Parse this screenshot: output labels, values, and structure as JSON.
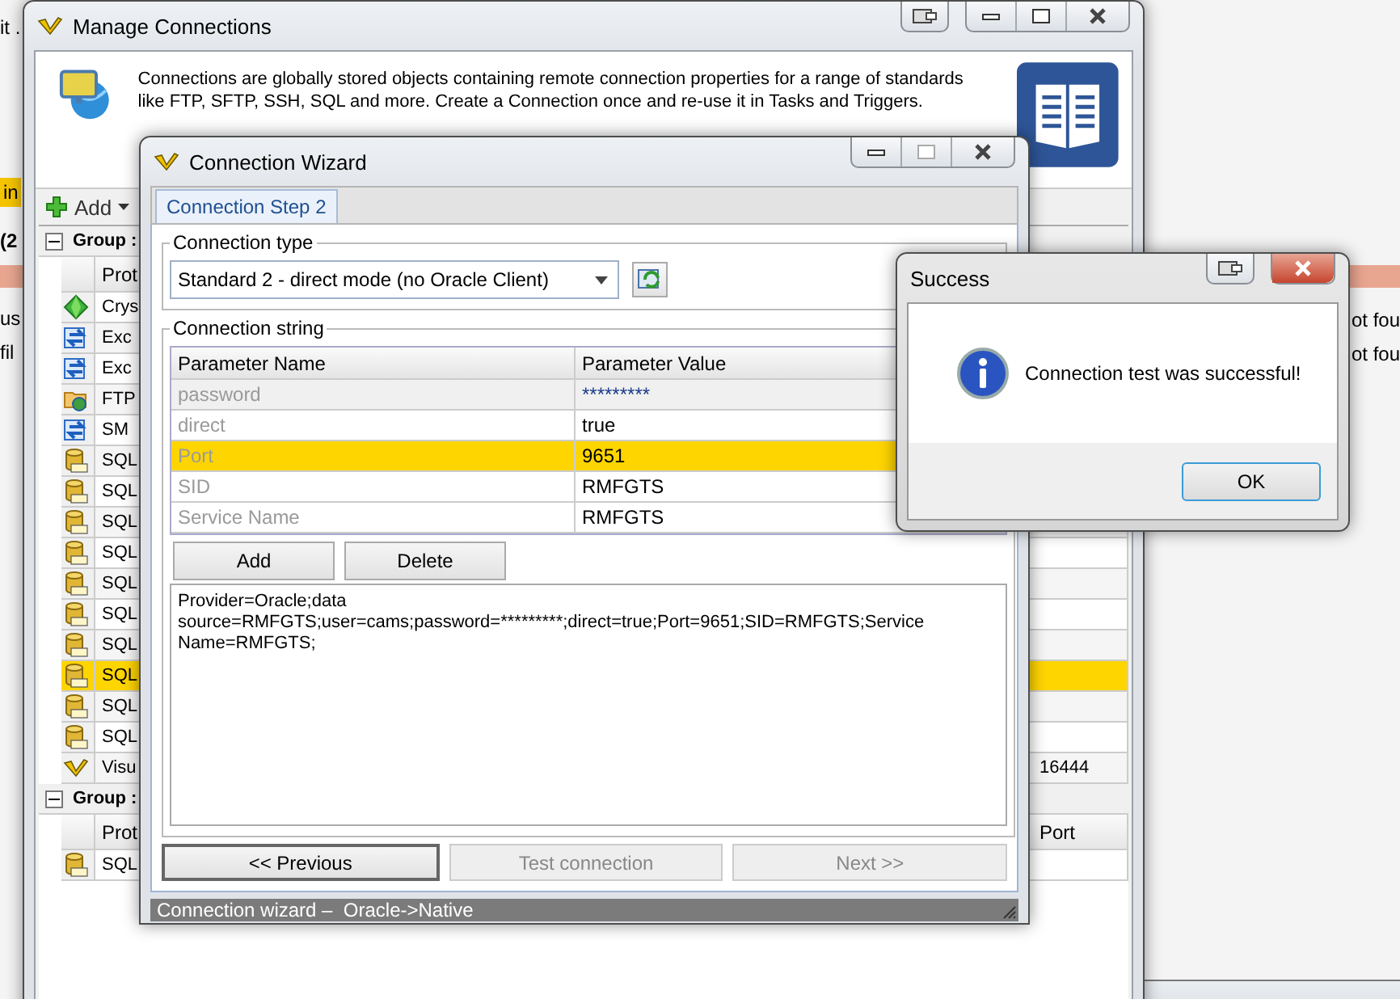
{
  "background_window": {
    "left_fragments": [
      {
        "text": "it .",
        "kind": "plain"
      },
      {
        "text": "in",
        "kind": "highlight"
      },
      {
        "text": "(2",
        "kind": "bold"
      },
      {
        "text": "us",
        "kind": "plain"
      },
      {
        "text": "fil",
        "kind": "plain"
      }
    ],
    "right_fragments": [
      "ot fou",
      "ot fou"
    ]
  },
  "manage": {
    "title": "Manage Connections",
    "description": "Connections are globally stored objects containing remote connection properties for a range of standards like FTP, SFTP,  SSH, SQL and more. Create a Connection once and re-use it in Tasks and Triggers.",
    "toolbar": [
      {
        "label": "Add"
      }
    ],
    "groups": [
      {
        "label": "Group :",
        "expanded": true,
        "columns": [
          "Prot"
        ],
        "rows": [
          {
            "kind": "gem",
            "protocol": "Crys",
            "selected": false
          },
          {
            "kind": "exchange",
            "protocol": "Exc",
            "selected": false
          },
          {
            "kind": "exchange",
            "protocol": "Exc",
            "selected": false
          },
          {
            "kind": "folder",
            "protocol": "FTP",
            "selected": false
          },
          {
            "kind": "exchange",
            "protocol": "SM",
            "selected": false
          },
          {
            "kind": "sql",
            "protocol": "SQL",
            "selected": false
          },
          {
            "kind": "sql",
            "protocol": "SQL",
            "selected": false
          },
          {
            "kind": "sql",
            "protocol": "SQL",
            "selected": false
          },
          {
            "kind": "sql",
            "protocol": "SQL",
            "selected": false
          },
          {
            "kind": "sql",
            "protocol": "SQL",
            "selected": false
          },
          {
            "kind": "sql",
            "protocol": "SQL",
            "selected": false
          },
          {
            "kind": "sql",
            "protocol": "SQL",
            "selected": false
          },
          {
            "kind": "sql",
            "protocol": "SQL",
            "selected": true
          },
          {
            "kind": "sql",
            "protocol": "SQL",
            "selected": false
          },
          {
            "kind": "sql",
            "protocol": "SQL",
            "selected": false
          },
          {
            "kind": "vlogo",
            "protocol": "Visu",
            "port": "16444",
            "selected": false
          }
        ]
      },
      {
        "label": "Group :",
        "expanded": true,
        "columns": [
          "Prot",
          "Port"
        ],
        "rows": [
          {
            "kind": "sql",
            "protocol": "SQL",
            "selected": false
          }
        ]
      }
    ]
  },
  "wizard": {
    "title": "Connection Wizard",
    "tabs": [
      {
        "label": "Connection Step 2",
        "selected": true
      }
    ],
    "connection_type": {
      "label": "Connection type",
      "value": "Standard 2 - direct mode (no Oracle Client)"
    },
    "connection_string": {
      "label": "Connection string",
      "columns": [
        "Parameter Name",
        "Parameter Value"
      ],
      "parameters": [
        {
          "name": "password",
          "value": "*********",
          "masked": true,
          "selected": false
        },
        {
          "name": "direct",
          "value": "true",
          "masked": false,
          "selected": false
        },
        {
          "name": "Port",
          "value": "9651",
          "masked": false,
          "selected": true
        },
        {
          "name": "SID",
          "value": "RMFGTS",
          "masked": false,
          "selected": false
        },
        {
          "name": "Service Name",
          "value": "RMFGTS",
          "masked": false,
          "selected": false
        }
      ],
      "buttons": [
        "Add",
        "Delete"
      ],
      "text": "Provider=Oracle;data source=RMFGTS;user=cams;password=*********;direct=true;Port=9651;SID=RMFGTS;Service Name=RMFGTS;"
    },
    "nav_buttons": [
      {
        "label": "<< Previous",
        "disabled": false,
        "default": true
      },
      {
        "label": "Test connection",
        "disabled": true,
        "default": false
      },
      {
        "label": "Next >>",
        "disabled": true,
        "default": false
      }
    ],
    "status": "Connection wizard –  Oracle->Native"
  },
  "dialog": {
    "title": "Success",
    "message": "Connection test was successful!",
    "buttons": [
      "OK"
    ]
  }
}
